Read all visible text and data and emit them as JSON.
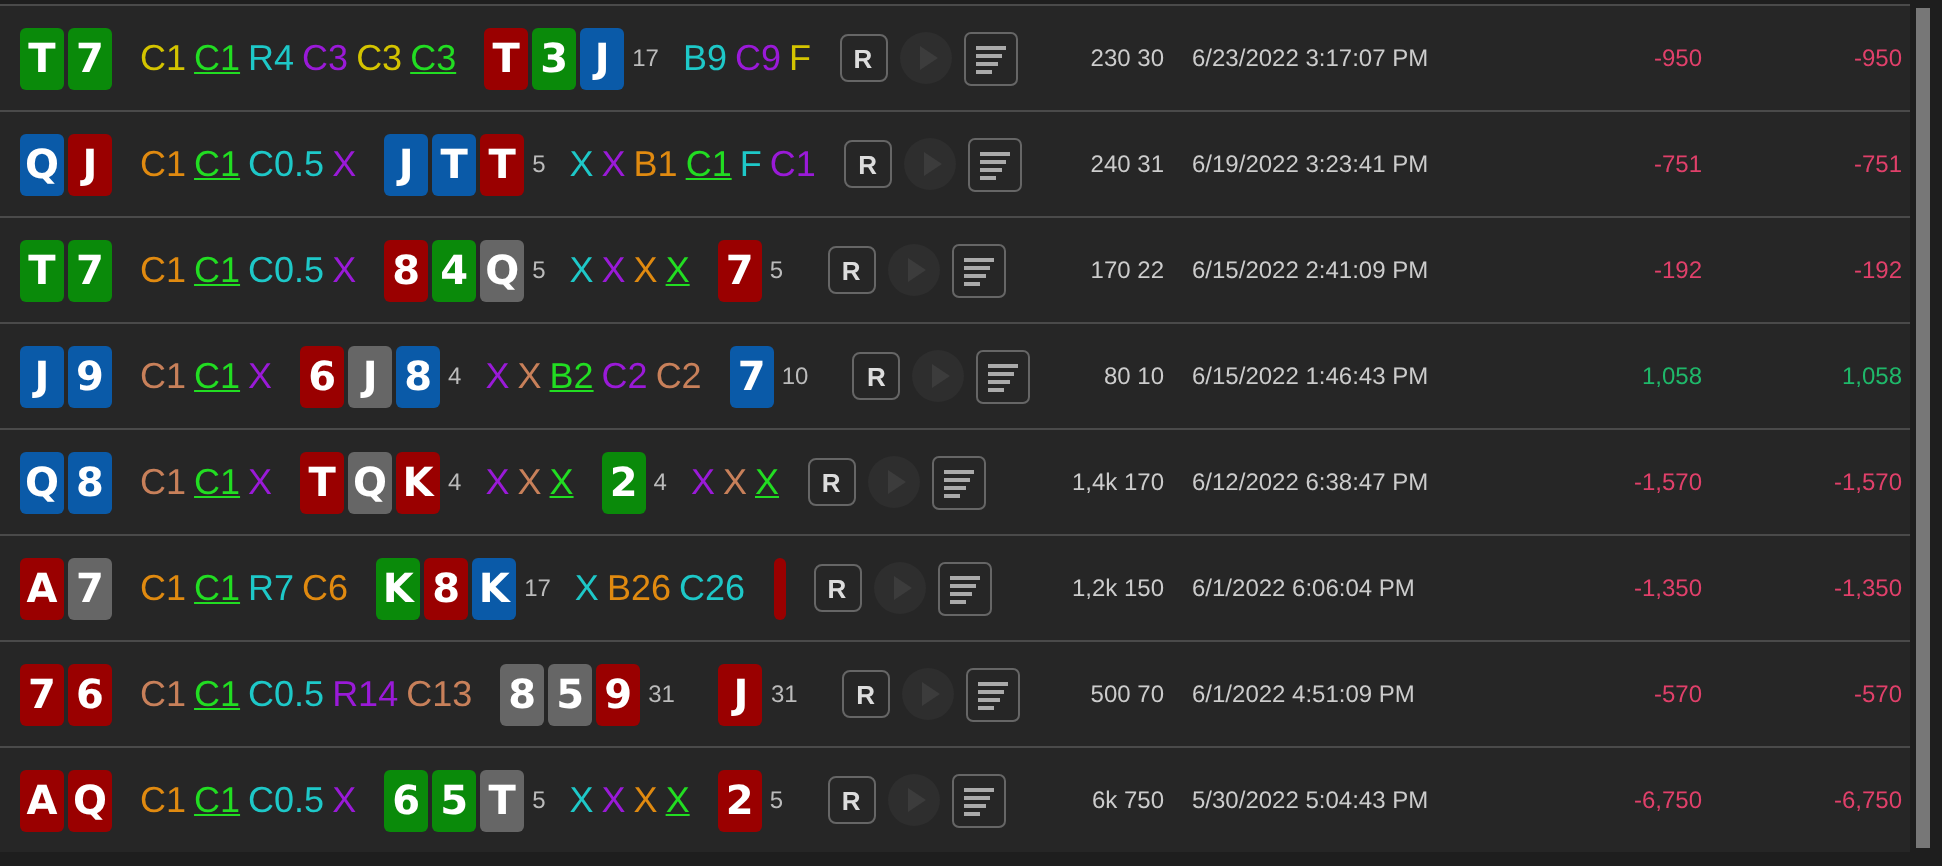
{
  "rows": [
    {
      "hole": [
        {
          "rank": "T",
          "color": "#0a8a0a"
        },
        {
          "rank": "7",
          "color": "#0a8a0a"
        }
      ],
      "streets": [
        {
          "actions": [
            {
              "text": "C1",
              "color": "#d4c400",
              "hero": false
            },
            {
              "text": "C1",
              "color": "#22dd22",
              "hero": true
            },
            {
              "text": "R4",
              "color": "#1ec8c8",
              "hero": false
            },
            {
              "text": "C3",
              "color": "#9a1ad8",
              "hero": false
            },
            {
              "text": "C3",
              "color": "#d4c400",
              "hero": false
            },
            {
              "text": "C3",
              "color": "#22dd22",
              "hero": true
            }
          ]
        },
        {
          "board": [
            {
              "rank": "T",
              "color": "#9a0000"
            },
            {
              "rank": "3",
              "color": "#0a8a0a"
            },
            {
              "rank": "J",
              "color": "#0a5aa8"
            }
          ],
          "pot": "17",
          "actions": [
            {
              "text": "B9",
              "color": "#1ec8c8",
              "hero": false
            },
            {
              "text": "C9",
              "color": "#9a1ad8",
              "hero": false
            },
            {
              "text": "F",
              "color": "#d4c400",
              "hero": false
            }
          ]
        }
      ],
      "button": "R",
      "stake": "230 30",
      "date": "6/23/2022 3:17:07 PM",
      "result": {
        "text": "-950",
        "color": "#e0406a"
      },
      "result_2": {
        "text": "-950",
        "color": "#e0406a"
      }
    },
    {
      "hole": [
        {
          "rank": "Q",
          "color": "#0a5aa8"
        },
        {
          "rank": "J",
          "color": "#9a0000"
        }
      ],
      "streets": [
        {
          "actions": [
            {
              "text": "C1",
              "color": "#e08a10",
              "hero": false
            },
            {
              "text": "C1",
              "color": "#22dd22",
              "hero": true
            },
            {
              "text": "C0.5",
              "color": "#1ec8c8",
              "hero": false
            },
            {
              "text": "X",
              "color": "#9a1ad8",
              "hero": false
            }
          ]
        },
        {
          "board": [
            {
              "rank": "J",
              "color": "#0a5aa8"
            },
            {
              "rank": "T",
              "color": "#0a5aa8"
            },
            {
              "rank": "T",
              "color": "#9a0000"
            }
          ],
          "pot": "5",
          "actions": [
            {
              "text": "X",
              "color": "#1ec8c8",
              "hero": false
            },
            {
              "text": "X",
              "color": "#9a1ad8",
              "hero": false
            },
            {
              "text": "B1",
              "color": "#e08a10",
              "hero": false
            },
            {
              "text": "C1",
              "color": "#22dd22",
              "hero": true
            },
            {
              "text": "F",
              "color": "#1ec8c8",
              "hero": false
            },
            {
              "text": "C1",
              "color": "#9a1ad8",
              "hero": false
            }
          ]
        }
      ],
      "button": "R",
      "stake": "240 31",
      "date": "6/19/2022 3:23:41 PM",
      "result": {
        "text": "-751",
        "color": "#e0406a"
      },
      "result_2": {
        "text": "-751",
        "color": "#e0406a"
      }
    },
    {
      "hole": [
        {
          "rank": "T",
          "color": "#0a8a0a"
        },
        {
          "rank": "7",
          "color": "#0a8a0a"
        }
      ],
      "streets": [
        {
          "actions": [
            {
              "text": "C1",
              "color": "#e08a10",
              "hero": false
            },
            {
              "text": "C1",
              "color": "#22dd22",
              "hero": true
            },
            {
              "text": "C0.5",
              "color": "#1ec8c8",
              "hero": false
            },
            {
              "text": "X",
              "color": "#9a1ad8",
              "hero": false
            }
          ]
        },
        {
          "board": [
            {
              "rank": "8",
              "color": "#9a0000"
            },
            {
              "rank": "4",
              "color": "#0a8a0a"
            },
            {
              "rank": "Q",
              "color": "#666666"
            }
          ],
          "pot": "5",
          "actions": [
            {
              "text": "X",
              "color": "#1ec8c8",
              "hero": false
            },
            {
              "text": "X",
              "color": "#9a1ad8",
              "hero": false
            },
            {
              "text": "X",
              "color": "#e08a10",
              "hero": false
            },
            {
              "text": "X",
              "color": "#22dd22",
              "hero": true
            }
          ]
        },
        {
          "board": [
            {
              "rank": "7",
              "color": "#9a0000"
            }
          ],
          "pot": "5"
        }
      ],
      "button": "R",
      "stake": "170 22",
      "date": "6/15/2022 2:41:09 PM",
      "result": {
        "text": "-192",
        "color": "#e0406a"
      },
      "result_2": {
        "text": "-192",
        "color": "#e0406a"
      }
    },
    {
      "hole": [
        {
          "rank": "J",
          "color": "#0a5aa8"
        },
        {
          "rank": "9",
          "color": "#0a5aa8"
        }
      ],
      "streets": [
        {
          "actions": [
            {
              "text": "C1",
              "color": "#c8805a",
              "hero": false
            },
            {
              "text": "C1",
              "color": "#22dd22",
              "hero": true
            },
            {
              "text": "X",
              "color": "#9a1ad8",
              "hero": false
            }
          ]
        },
        {
          "board": [
            {
              "rank": "6",
              "color": "#9a0000"
            },
            {
              "rank": "J",
              "color": "#666666"
            },
            {
              "rank": "8",
              "color": "#0a5aa8"
            }
          ],
          "pot": "4",
          "actions": [
            {
              "text": "X",
              "color": "#9a1ad8",
              "hero": false
            },
            {
              "text": "X",
              "color": "#c8805a",
              "hero": false
            },
            {
              "text": "B2",
              "color": "#22dd22",
              "hero": true
            },
            {
              "text": "C2",
              "color": "#9a1ad8",
              "hero": false
            },
            {
              "text": "C2",
              "color": "#c8805a",
              "hero": false
            }
          ]
        },
        {
          "board": [
            {
              "rank": "7",
              "color": "#0a5aa8"
            }
          ],
          "pot": "10"
        }
      ],
      "button": "R",
      "stake": "80 10",
      "date": "6/15/2022 1:46:43 PM",
      "result": {
        "text": "1,058",
        "color": "#1fb86a"
      },
      "result_2": {
        "text": "1,058",
        "color": "#1fb86a"
      }
    },
    {
      "hole": [
        {
          "rank": "Q",
          "color": "#0a5aa8"
        },
        {
          "rank": "8",
          "color": "#0a5aa8"
        }
      ],
      "streets": [
        {
          "actions": [
            {
              "text": "C1",
              "color": "#c8805a",
              "hero": false
            },
            {
              "text": "C1",
              "color": "#22dd22",
              "hero": true
            },
            {
              "text": "X",
              "color": "#9a1ad8",
              "hero": false
            }
          ]
        },
        {
          "board": [
            {
              "rank": "T",
              "color": "#9a0000"
            },
            {
              "rank": "Q",
              "color": "#666666"
            },
            {
              "rank": "K",
              "color": "#9a0000"
            }
          ],
          "pot": "4",
          "actions": [
            {
              "text": "X",
              "color": "#9a1ad8",
              "hero": false
            },
            {
              "text": "X",
              "color": "#c8805a",
              "hero": false
            },
            {
              "text": "X",
              "color": "#22dd22",
              "hero": true
            }
          ]
        },
        {
          "board": [
            {
              "rank": "2",
              "color": "#0a8a0a"
            }
          ],
          "pot": "4",
          "actions": [
            {
              "text": "X",
              "color": "#9a1ad8",
              "hero": false
            },
            {
              "text": "X",
              "color": "#c8805a",
              "hero": false
            },
            {
              "text": "X",
              "color": "#22dd22",
              "hero": true
            }
          ]
        }
      ],
      "button": "R",
      "stake": "1,4k 170",
      "date": "6/12/2022 6:38:47 PM",
      "result": {
        "text": "-1,570",
        "color": "#e0406a"
      },
      "result_2": {
        "text": "-1,570",
        "color": "#e0406a"
      }
    },
    {
      "hole": [
        {
          "rank": "A",
          "color": "#9a0000"
        },
        {
          "rank": "7",
          "color": "#666666"
        }
      ],
      "streets": [
        {
          "actions": [
            {
              "text": "C1",
              "color": "#e08a10",
              "hero": false
            },
            {
              "text": "C1",
              "color": "#22dd22",
              "hero": true
            },
            {
              "text": "R7",
              "color": "#1ec8c8",
              "hero": false
            },
            {
              "text": "C6",
              "color": "#e08a10",
              "hero": false
            }
          ]
        },
        {
          "board": [
            {
              "rank": "K",
              "color": "#0a8a0a"
            },
            {
              "rank": "8",
              "color": "#9a0000"
            },
            {
              "rank": "K",
              "color": "#0a5aa8"
            }
          ],
          "pot": "17",
          "actions": [
            {
              "text": "X",
              "color": "#1ec8c8",
              "hero": false
            },
            {
              "text": "B26",
              "color": "#e08a10",
              "hero": false
            },
            {
              "text": "C26",
              "color": "#1ec8c8",
              "hero": false
            }
          ]
        },
        {
          "board": [
            {
              "color": "#9a0000"
            }
          ]
        }
      ],
      "button": "R",
      "stake": "1,2k 150",
      "date": "6/1/2022 6:06:04 PM",
      "result": {
        "text": "-1,350",
        "color": "#e0406a"
      },
      "result_2": {
        "text": "-1,350",
        "color": "#e0406a"
      }
    },
    {
      "hole": [
        {
          "rank": "7",
          "color": "#9a0000"
        },
        {
          "rank": "6",
          "color": "#9a0000"
        }
      ],
      "streets": [
        {
          "actions": [
            {
              "text": "C1",
              "color": "#c8805a",
              "hero": false
            },
            {
              "text": "C1",
              "color": "#22dd22",
              "hero": true
            },
            {
              "text": "C0.5",
              "color": "#1ec8c8",
              "hero": false
            },
            {
              "text": "R14",
              "color": "#9a1ad8",
              "hero": false
            },
            {
              "text": "C13",
              "color": "#c8805a",
              "hero": false
            }
          ]
        },
        {
          "board": [
            {
              "rank": "8",
              "color": "#666666"
            },
            {
              "rank": "5",
              "color": "#666666"
            },
            {
              "rank": "9",
              "color": "#9a0000"
            }
          ],
          "pot": "31"
        },
        {
          "board": [
            {
              "rank": "J",
              "color": "#9a0000"
            }
          ],
          "pot": "31"
        }
      ],
      "button": "R",
      "stake": "500 70",
      "date": "6/1/2022 4:51:09 PM",
      "result": {
        "text": "-570",
        "color": "#e0406a"
      },
      "result_2": {
        "text": "-570",
        "color": "#e0406a"
      }
    },
    {
      "hole": [
        {
          "rank": "A",
          "color": "#9a0000"
        },
        {
          "rank": "Q",
          "color": "#9a0000"
        }
      ],
      "streets": [
        {
          "actions": [
            {
              "text": "C1",
              "color": "#e08a10",
              "hero": false
            },
            {
              "text": "C1",
              "color": "#22dd22",
              "hero": true
            },
            {
              "text": "C0.5",
              "color": "#1ec8c8",
              "hero": false
            },
            {
              "text": "X",
              "color": "#9a1ad8",
              "hero": false
            }
          ]
        },
        {
          "board": [
            {
              "rank": "6",
              "color": "#0a8a0a"
            },
            {
              "rank": "5",
              "color": "#0a8a0a"
            },
            {
              "rank": "T",
              "color": "#666666"
            }
          ],
          "pot": "5",
          "actions": [
            {
              "text": "X",
              "color": "#1ec8c8",
              "hero": false
            },
            {
              "text": "X",
              "color": "#9a1ad8",
              "hero": false
            },
            {
              "text": "X",
              "color": "#e08a10",
              "hero": false
            },
            {
              "text": "X",
              "color": "#22dd22",
              "hero": true
            }
          ]
        },
        {
          "board": [
            {
              "rank": "2",
              "color": "#9a0000"
            }
          ],
          "pot": "5"
        }
      ],
      "button": "R",
      "stake": "6k 750",
      "date": "5/30/2022 5:04:43 PM",
      "result": {
        "text": "-6,750",
        "color": "#e0406a"
      },
      "result_2": {
        "text": "-6,750",
        "color": "#e0406a"
      }
    }
  ]
}
